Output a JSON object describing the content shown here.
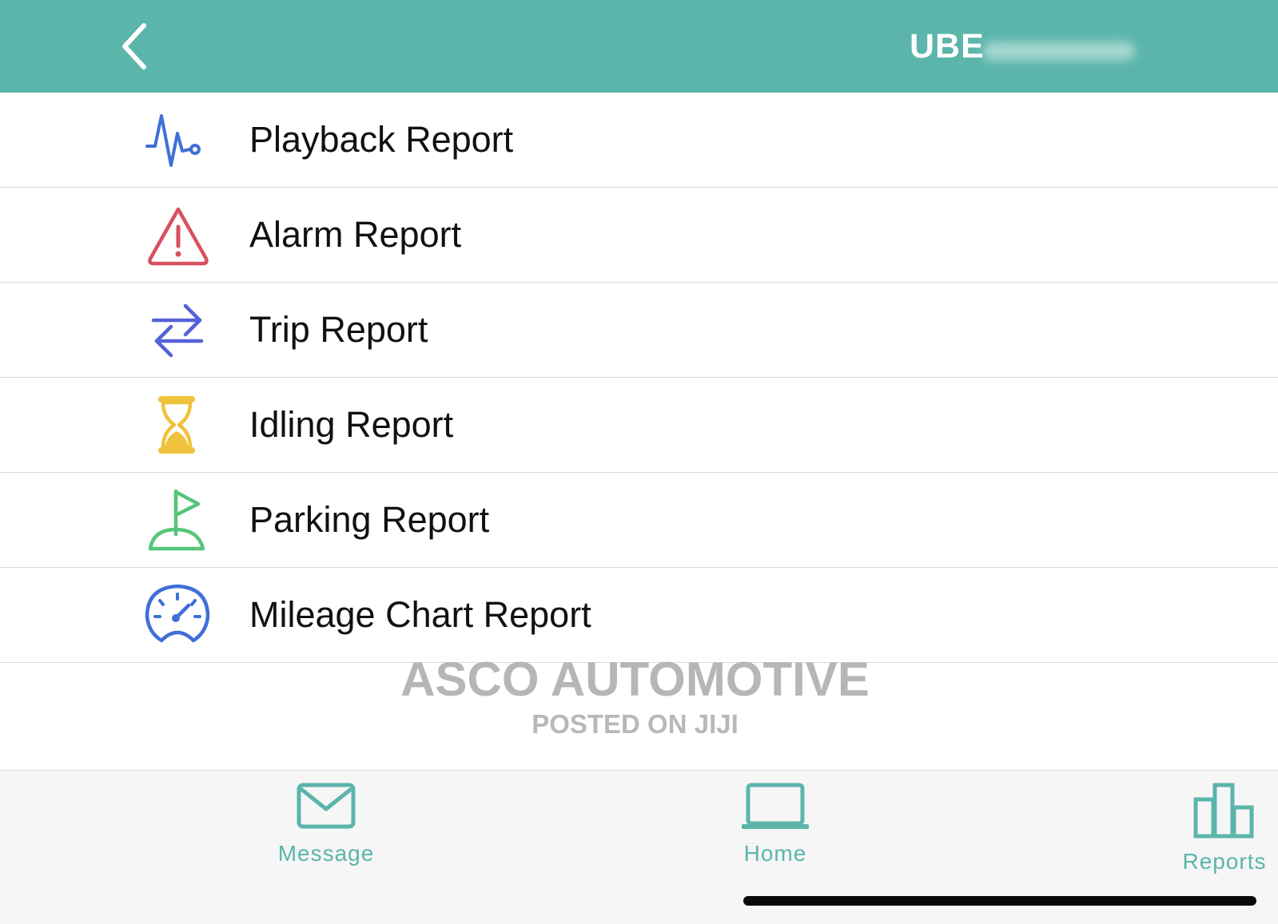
{
  "header": {
    "title": "UBE",
    "background_color": "#5bb5ab",
    "back_icon": "chevron-left-icon"
  },
  "reports": [
    {
      "label": "Playback Report",
      "icon": "pulse-icon",
      "color": "#3f6fd8"
    },
    {
      "label": "Alarm Report",
      "icon": "warning-icon",
      "color": "#d9505e"
    },
    {
      "label": "Trip Report",
      "icon": "swap-arrows-icon",
      "color": "#5462d8"
    },
    {
      "label": "Idling Report",
      "icon": "hourglass-icon",
      "color": "#f0c23b"
    },
    {
      "label": "Parking Report",
      "icon": "flag-icon",
      "color": "#56c57a"
    },
    {
      "label": "Mileage Chart Report",
      "icon": "speedometer-icon",
      "color": "#3f6fd8"
    }
  ],
  "watermark": {
    "main": "ASCO AUTOMOTIVE",
    "sub": "POSTED ON JIJI"
  },
  "tab_bar": {
    "tabs": [
      {
        "label": "Message",
        "icon": "envelope-icon"
      },
      {
        "label": "Home",
        "icon": "laptop-icon"
      },
      {
        "label": "Reports",
        "icon": "bar-chart-icon"
      }
    ],
    "accent_color": "#5bb5ab"
  }
}
